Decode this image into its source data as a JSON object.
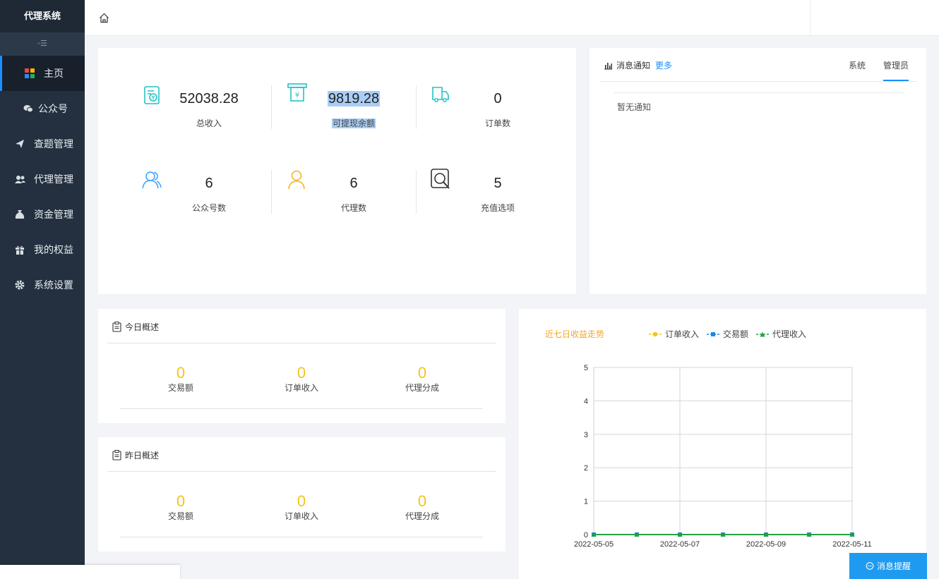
{
  "app": {
    "title": "代理系统"
  },
  "sidebar": {
    "collapse_icon": "menu-collapse-icon",
    "items": [
      {
        "label": "主页",
        "icon": "home-grid-icon",
        "active": true
      },
      {
        "label": "公众号",
        "icon": "wechat-icon"
      },
      {
        "label": "查题管理",
        "icon": "paper-plane-icon"
      },
      {
        "label": "代理管理",
        "icon": "users-icon"
      },
      {
        "label": "资金管理",
        "icon": "money-bag-icon"
      },
      {
        "label": "我的权益",
        "icon": "gift-icon"
      },
      {
        "label": "系统设置",
        "icon": "gear-icon"
      }
    ]
  },
  "stats": [
    {
      "value": "52038.28",
      "label": "总收入",
      "icon": "revenue-icon",
      "color": "#22c3c6"
    },
    {
      "value": "9819.28",
      "label": "可提现余额",
      "icon": "withdraw-icon",
      "color": "#22c3c6"
    },
    {
      "value": "0",
      "label": "订单数",
      "icon": "truck-icon",
      "color": "#22c3c6"
    },
    {
      "value": "6",
      "label": "公众号数",
      "icon": "users-icon",
      "color": "#3aa0ff"
    },
    {
      "value": "6",
      "label": "代理数",
      "icon": "user-icon",
      "color": "#f6b51e"
    },
    {
      "value": "5",
      "label": "充值选项",
      "icon": "search-icon",
      "color": "#333333"
    }
  ],
  "notice": {
    "title": "消息通知",
    "more": "更多",
    "tabs": [
      "系统",
      "管理员"
    ],
    "active_tab": "管理员",
    "empty": "暂无通知"
  },
  "today": {
    "title": "今日概述",
    "items": [
      {
        "value": "0",
        "label": "交易额"
      },
      {
        "value": "0",
        "label": "订单收入"
      },
      {
        "value": "0",
        "label": "代理分成"
      }
    ]
  },
  "yesterday": {
    "title": "昨日概述",
    "items": [
      {
        "value": "0",
        "label": "交易额"
      },
      {
        "value": "0",
        "label": "订单收入"
      },
      {
        "value": "0",
        "label": "代理分成"
      }
    ]
  },
  "chart_data": {
    "type": "line",
    "title": "近七日收益走势",
    "x": [
      "2022-05-05",
      "2022-05-06",
      "2022-05-07",
      "2022-05-08",
      "2022-05-09",
      "2022-05-10",
      "2022-05-11"
    ],
    "x_tick_labels": [
      "2022-05-05",
      "2022-05-07",
      "2022-05-09",
      "2022-05-11"
    ],
    "series": [
      {
        "name": "订单收入",
        "values": [
          0,
          0,
          0,
          0,
          0,
          0,
          0
        ],
        "color": "#f5c518",
        "marker": "circle"
      },
      {
        "name": "交易额",
        "values": [
          0,
          0,
          0,
          0,
          0,
          0,
          0
        ],
        "color": "#1e88e5",
        "marker": "square"
      },
      {
        "name": "代理收入",
        "values": [
          0,
          0,
          0,
          0,
          0,
          0,
          0
        ],
        "color": "#23a047",
        "marker": "triangle"
      }
    ],
    "ylim": [
      0,
      5
    ],
    "yticks": [
      0,
      1,
      2,
      3,
      4,
      5
    ],
    "grid": true,
    "legend_position": "top"
  },
  "message_button": {
    "label": "消息提醒",
    "icon": "chat-icon"
  }
}
